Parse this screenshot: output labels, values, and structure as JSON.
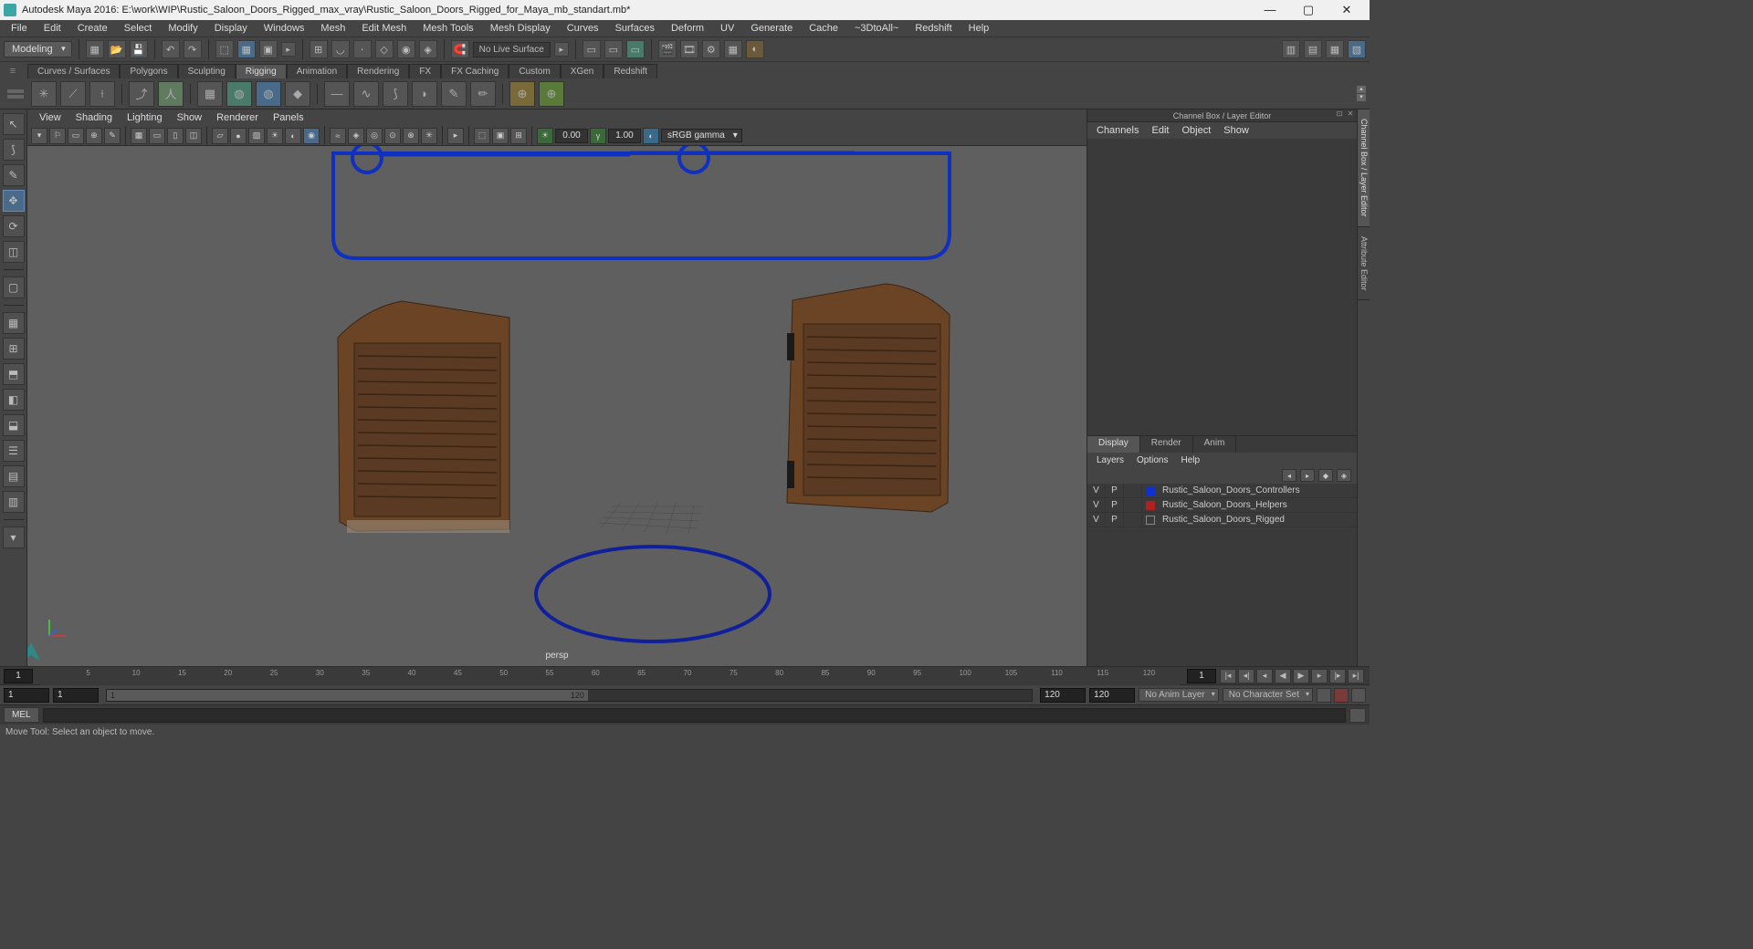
{
  "title": "Autodesk Maya 2016: E:\\work\\WIP\\Rustic_Saloon_Doors_Rigged_max_vray\\Rustic_Saloon_Doors_Rigged_for_Maya_mb_standart.mb*",
  "menus": [
    "File",
    "Edit",
    "Create",
    "Select",
    "Modify",
    "Display",
    "Windows",
    "Mesh",
    "Edit Mesh",
    "Mesh Tools",
    "Mesh Display",
    "Curves",
    "Surfaces",
    "Deform",
    "UV",
    "Generate",
    "Cache",
    "~3DtoAll~",
    "Redshift",
    "Help"
  ],
  "workspace": "Modeling",
  "no_live_surface": "No Live Surface",
  "shelf_tabs": [
    "Curves / Surfaces",
    "Polygons",
    "Sculpting",
    "Rigging",
    "Animation",
    "Rendering",
    "FX",
    "FX Caching",
    "Custom",
    "XGen",
    "Redshift"
  ],
  "active_shelf": "Rigging",
  "panel_menus": [
    "View",
    "Shading",
    "Lighting",
    "Show",
    "Renderer",
    "Panels"
  ],
  "exposure": "0.00",
  "gamma_val": "1.00",
  "gamma_mode": "sRGB gamma",
  "persp": "persp",
  "channel_box_title": "Channel Box / Layer Editor",
  "cb_menus": [
    "Channels",
    "Edit",
    "Object",
    "Show"
  ],
  "layer_tabs": [
    "Display",
    "Render",
    "Anim"
  ],
  "layer_menus": [
    "Layers",
    "Options",
    "Help"
  ],
  "layers": [
    {
      "v": "V",
      "p": "P",
      "color": "#1030d0",
      "name": "Rustic_Saloon_Doors_Controllers"
    },
    {
      "v": "V",
      "p": "P",
      "color": "#b02020",
      "name": "Rustic_Saloon_Doors_Helpers"
    },
    {
      "v": "V",
      "p": "P",
      "color": "transparent",
      "name": "Rustic_Saloon_Doors_Rigged",
      "outline": true
    }
  ],
  "vtabs": [
    "Channel Box / Layer Editor",
    "Attribute Editor"
  ],
  "time_start": "1",
  "time_end": "1",
  "time_cur": "1",
  "time_ticks": [
    5,
    10,
    15,
    20,
    25,
    30,
    35,
    40,
    45,
    50,
    55,
    60,
    65,
    70,
    75,
    80,
    85,
    90,
    95,
    100,
    105,
    110,
    115,
    120
  ],
  "range_start": "1",
  "range_inner_start": "1",
  "range_inner_end": "120",
  "range_end": "120",
  "anim_layer": "No Anim Layer",
  "char_set": "No Character Set",
  "mel": "MEL",
  "helpline": "Move Tool: Select an object to move."
}
